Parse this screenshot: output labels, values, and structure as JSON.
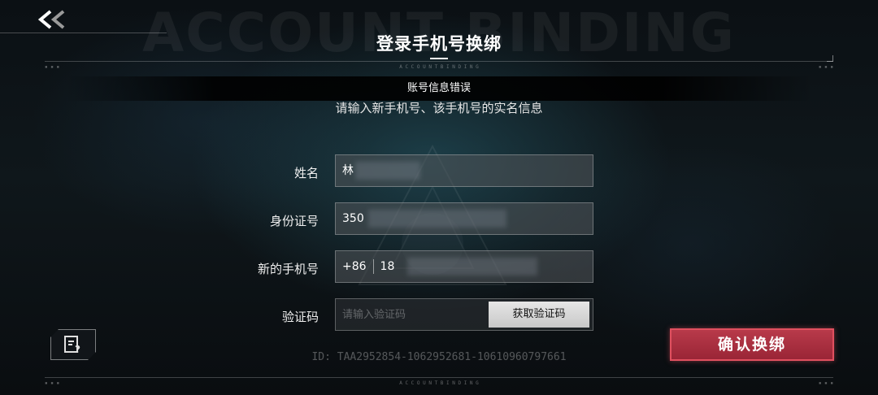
{
  "header": {
    "title": "登录手机号换绑",
    "background_word": "ACCOUNT BINDING",
    "sub_ticker": "A C C O U N T   B I N D I N G"
  },
  "toast": {
    "message": "账号信息错误"
  },
  "instruction": "请输入新手机号、该手机号的实名信息",
  "form": {
    "name": {
      "label": "姓名",
      "value": "林"
    },
    "id_number": {
      "label": "身份证号",
      "value": "350"
    },
    "phone": {
      "label": "新的手机号",
      "prefix": "+86",
      "value": "18"
    },
    "code": {
      "label": "验证码",
      "placeholder": "请输入验证码",
      "button": "获取验证码"
    }
  },
  "footer": {
    "account_id": "ID: TAA2952854-1062952681-10610960797661",
    "confirm_button": "确认换绑"
  },
  "colors": {
    "confirm": "#b83a4a",
    "confirm_border": "#e0505f"
  },
  "icons": [
    "back-double-chevron-icon",
    "feedback-document-icon"
  ]
}
